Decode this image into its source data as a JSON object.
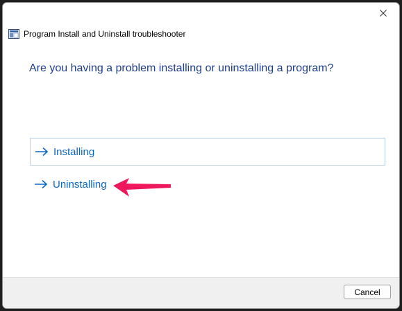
{
  "window": {
    "title": "Program Install and Uninstall troubleshooter",
    "icons": {
      "app": "troubleshooter-app-icon",
      "close": "close-icon"
    }
  },
  "main": {
    "question": "Are you having a problem installing or uninstalling a program?",
    "options": [
      {
        "label": "Installing",
        "icon": "right-arrow-icon",
        "highlighted": true
      },
      {
        "label": "Uninstalling",
        "icon": "right-arrow-icon",
        "highlighted": false
      }
    ]
  },
  "annotation": {
    "icon": "pointer-arrow-icon",
    "color": "#f0185c"
  },
  "footer": {
    "cancel_label": "Cancel"
  },
  "colors": {
    "question": "#1e3d8f",
    "link": "#0b67c2",
    "highlight_border": "#b9d1e8"
  }
}
